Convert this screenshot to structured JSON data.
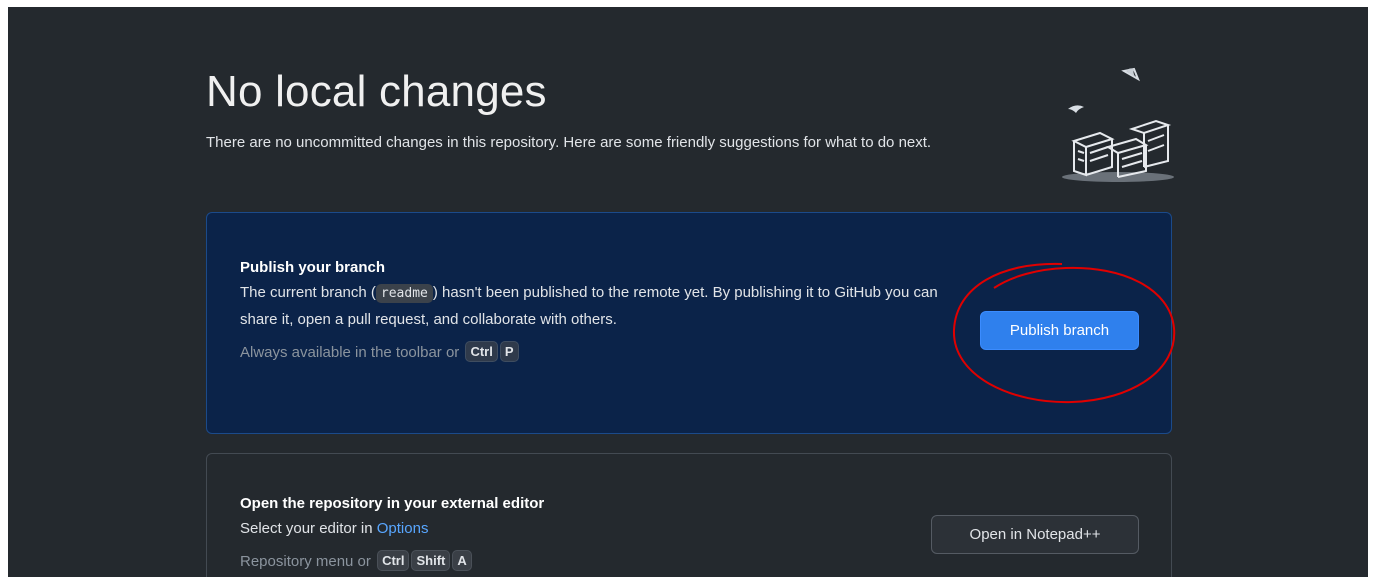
{
  "header": {
    "title": "No local changes",
    "subtitle": "There are no uncommitted changes in this repository. Here are some friendly suggestions for what to do next."
  },
  "publish_card": {
    "title": "Publish your branch",
    "desc_before": "The current branch (",
    "branch_name": "readme",
    "desc_after": ") hasn't been published to the remote yet. By publishing it to GitHub you can share it, open a pull request, and collaborate with others.",
    "hint": "Always available in the toolbar or",
    "shortcut": [
      "Ctrl",
      "P"
    ],
    "button_label": "Publish branch"
  },
  "editor_card": {
    "title": "Open the repository in your external editor",
    "desc": "Select your editor in",
    "link": "Options",
    "hint": "Repository menu or",
    "shortcut": [
      "Ctrl",
      "Shift",
      "A"
    ],
    "button_label": "Open in Notepad++"
  },
  "colors": {
    "background": "#24292e",
    "primary_card": "#0b2349",
    "accent": "#2f80ed",
    "link": "#58a6ff",
    "annotation": "#e00000"
  },
  "icons": {
    "illustration": "empty-boxes-illustration"
  }
}
